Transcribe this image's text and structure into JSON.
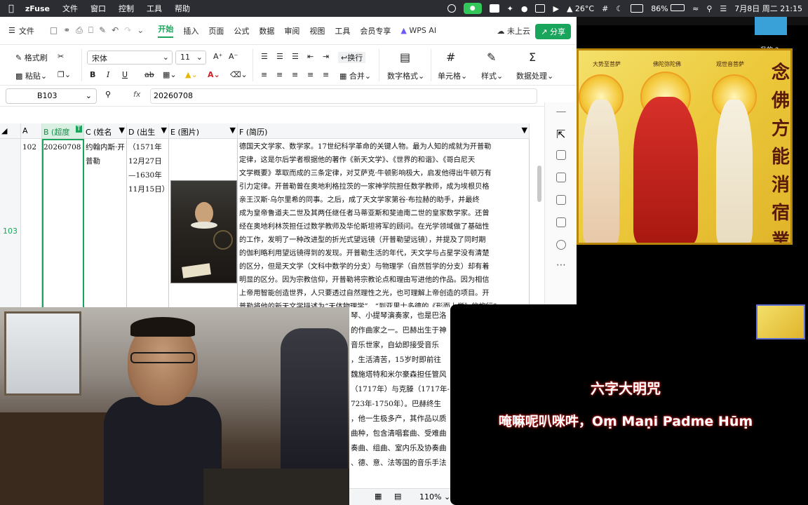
{
  "menubar": {
    "app_name": "zFuse",
    "items": [
      "文件",
      "窗口",
      "控制",
      "工具",
      "帮助"
    ],
    "weather": "26°C",
    "battery": "86%",
    "datetime": "7月8日 周二 21:15"
  },
  "wps": {
    "file_label": "文件",
    "tabs": [
      "开始",
      "插入",
      "页面",
      "公式",
      "数据",
      "审阅",
      "视图",
      "工具",
      "会员专享"
    ],
    "ai_label": "WPS AI",
    "cloud_label": "未上云",
    "share_label": "分享",
    "ribbon": {
      "format_painter": "格式刷",
      "paste": "粘贴",
      "font_name": "宋体",
      "font_size": "11",
      "wrap": "换行",
      "merge": "合并",
      "number_format": "数字格式",
      "cells": "单元格",
      "styles": "样式",
      "data_processing": "数据处理"
    },
    "name_box": "B103",
    "fx_label": "fx",
    "formula_value": "20260708",
    "columns": [
      "A",
      "B (超度",
      "C (姓名",
      "D (出生",
      "E (图片)",
      "F (简历)"
    ],
    "row_numbers": [
      "103"
    ],
    "row": {
      "a": "102",
      "b": "20260708",
      "c": "约翰内斯·开普勒",
      "d": "（1571年12月27日—1630年11月15日）",
      "f_lines": [
        "德国天文学家、数学家。17世纪科学革命的关键人物。最为人知的成就为开普勒",
        "定律，这是尔后学者根据他的著作《新天文学》、《世界的和谐》、《哥白尼天",
        "文学概要》萃取而成的三条定律，对艾萨克·牛顿影响极大，启发他得出牛顿万有",
        "引力定律。开普勒曾在奥地利格拉茨的一家神学院担任数学教师，成为埃根贝格",
        "亲王汉斯·乌尔里希的同事。之后，成了天文学家第谷·布拉赫的助手，并最终",
        "成为皇帝鲁道夫二世及其两任继任者马蒂亚斯和斐迪南二世的皇家数学家。还曾",
        "经在奥地利林茨担任过数学教师及华伦斯坦将军的顾问。在光学领域做了基础性",
        "的工作，发明了一种改进型的折光式望远镜（开普勒望远镜），并提及了同时期",
        "的伽利略利用望远镜得到的发现。开普勒生活的年代，天文学与占星学没有清楚",
        "的区分，但是天文学（文科中数学的分支）与物理学（自然哲学的分支）却有着",
        "明显的区分。因为宗教信仰，开普勒将宗教论点和理由写进他的作品。因为相信",
        "上帝用智能创造世界，人只要透过自然理性之光，也可理解上帝创造的项目。开",
        "普勒将他的新天文学描述为“天体物理学”、“到亚里士多德的《形而上学》的旅行”",
        "、“亚里士多德宇宙论的补充”、通过将天文学作为通用数学物理学的一部分改变",
        "古代传统的物理宇宙学。"
      ]
    },
    "next_row_lines": [
      "琴、小提琴演奏家，也是巴洛",
      "的作曲家之一。巴赫出生于神",
      "音乐世家，自幼即接受音乐",
      "，生活清苦，15岁时即前往",
      "魏施塔特和米尔豪森担任管风",
      "（1717年）与克滕（1717年-",
      "723年-1750年）。巴赫终生",
      "，他一生极多产，其作品以质",
      "曲种，包含清唱套曲、受难曲",
      "奏曲、组曲、室内乐及协奏曲",
      "、德、意、法等国的音乐手法",
      "音的精华与深奥的思想。但由",
      "在其身后被视为陈腐之物，"
    ],
    "zoom": "110%"
  },
  "rightscreen": {
    "label": "我的 2",
    "vertical_text": "念佛方能消宿業",
    "top_labels": [
      "大势至菩萨",
      "佛陀弥陀佛",
      "观世音菩萨"
    ]
  },
  "mantra": {
    "title": "六字大明咒",
    "text": "唵嘛呢叭咪吽，Oṃ Maṇi Padme Hūṃ"
  }
}
